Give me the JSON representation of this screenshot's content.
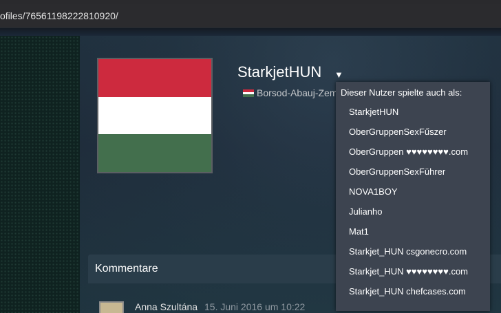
{
  "browser": {
    "url": "ofiles/76561198222810920/"
  },
  "profile": {
    "username": "StarkjetHUN",
    "dropdown_icon": "caret-down-icon",
    "location": "Borsod-Abauj-Zem",
    "flag_colors": [
      "#cd2a3e",
      "#ffffff",
      "#436f4d"
    ]
  },
  "alias_menu": {
    "header": "Dieser Nutzer spielte auch als:",
    "items": [
      "StarkjetHUN",
      "OberGruppenSexFűszer",
      "OberGruppen ♥♥♥♥♥♥♥♥.com",
      "OberGruppenSexFührer",
      "NOVA1BOY",
      "Julianho",
      "Mat1",
      "Starkjet_HUN csgonecro.com",
      "Starkjet_HUN ♥♥♥♥♥♥♥♥.com",
      "Starkjet_HUN chefcases.com"
    ]
  },
  "comments": {
    "title": "Kommentare",
    "first": {
      "author": "Anna Szultána",
      "date": "15. Juni 2016 um 10:22"
    }
  },
  "colors": {
    "page_bg": "#1b2838",
    "popup_bg": "#3d4450",
    "date_text": "#8f98a0"
  }
}
